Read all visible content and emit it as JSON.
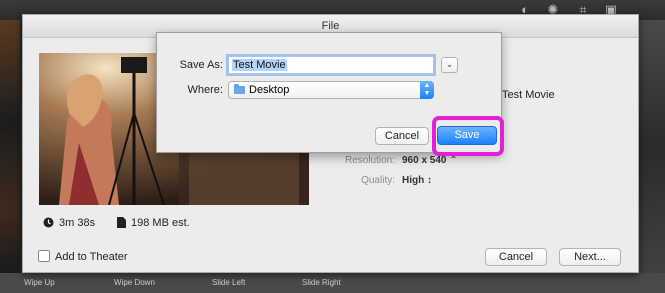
{
  "window": {
    "title": "File"
  },
  "bottom_transitions": [
    "Wipe Up",
    "Wipe Down",
    "Slide Left",
    "Slide Right"
  ],
  "export_sheet": {
    "duration": "3m 38s",
    "size": "198 MB est.",
    "title_value": "Test Movie",
    "resolution_label": "Resolution:",
    "resolution_value": "960 x 540",
    "quality_label": "Quality:",
    "quality_value": "High",
    "add_to_theater_label": "Add to Theater",
    "cancel_label": "Cancel",
    "next_label": "Next..."
  },
  "save_dialog": {
    "save_as_label": "Save As:",
    "save_as_value": "Test Movie",
    "where_label": "Where:",
    "where_value": "Desktop",
    "cancel_label": "Cancel",
    "save_label": "Save"
  },
  "colors": {
    "accent_blue": "#1a82fb",
    "highlight_magenta": "#e41fd8",
    "sheet_background": "#ececec"
  },
  "icons": [
    "clock-icon",
    "file-icon",
    "folder-icon",
    "popup-arrows-icon",
    "chevron-down-icon"
  ]
}
